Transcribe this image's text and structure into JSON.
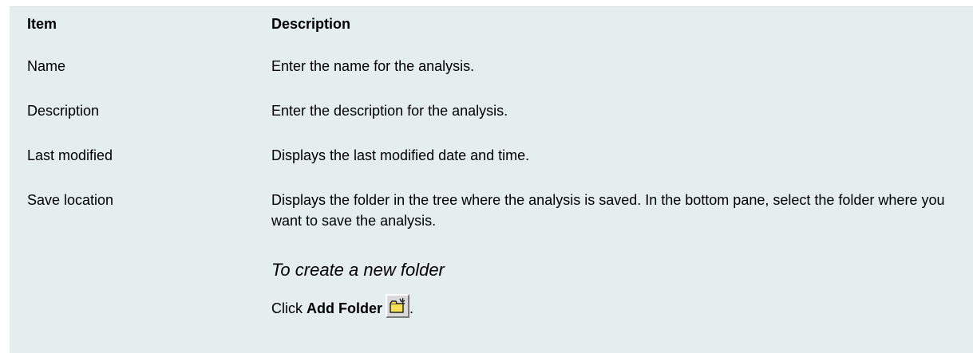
{
  "table": {
    "headers": {
      "item": "Item",
      "description": "Description"
    },
    "rows": [
      {
        "item": "Name",
        "description": "Enter the name for the analysis."
      },
      {
        "item": "Description",
        "description": "Enter the description for the analysis."
      },
      {
        "item": "Last modified",
        "description": "Displays the last modified date and time."
      },
      {
        "item": "Save location",
        "description": "Displays the folder in the tree where the analysis is saved. In the bottom pane, select the folder where you want to save the analysis."
      }
    ],
    "procedure": {
      "title": "To create a new folder",
      "click_text": "Click ",
      "button_label": "Add Folder",
      "period": ".",
      "icon": "add-folder-icon"
    }
  }
}
